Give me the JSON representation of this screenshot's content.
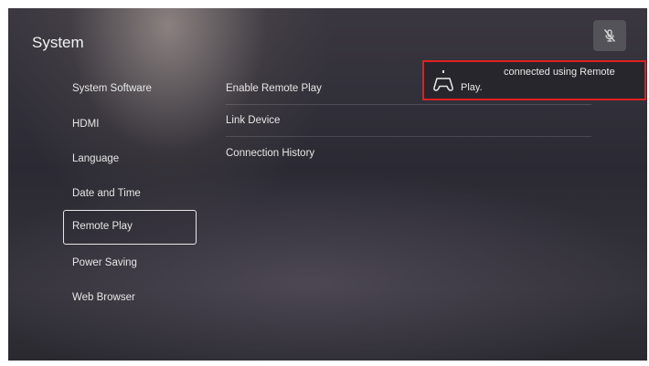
{
  "section_title": "System",
  "menu": {
    "items": [
      {
        "label": "System Software",
        "selected": false
      },
      {
        "label": "HDMI",
        "selected": false
      },
      {
        "label": "Language",
        "selected": false
      },
      {
        "label": "Date and Time",
        "selected": false
      },
      {
        "label": "Remote Play",
        "selected": true
      },
      {
        "label": "Power Saving",
        "selected": false
      },
      {
        "label": "Web Browser",
        "selected": false
      }
    ]
  },
  "options": {
    "items": [
      {
        "label": "Enable Remote Play"
      },
      {
        "label": "Link Device"
      },
      {
        "label": "Connection History"
      }
    ]
  },
  "notification": {
    "line1": "connected using Remote",
    "line2": "Play.",
    "icon": "controller-icon",
    "highlight_color": "#e02020"
  },
  "top_right": {
    "icon": "mic-muted-icon"
  }
}
